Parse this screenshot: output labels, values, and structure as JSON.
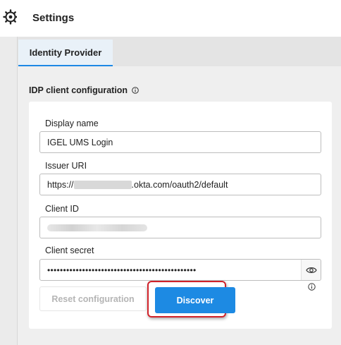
{
  "header": {
    "title": "Settings"
  },
  "tabs": [
    {
      "label": "Identity Provider",
      "active": true
    }
  ],
  "section": {
    "title": "IDP client configuration"
  },
  "form": {
    "display_name": {
      "label": "Display name",
      "value": "IGEL UMS Login"
    },
    "issuer_uri": {
      "label": "Issuer URI",
      "prefix": "https://",
      "suffix": ".okta.com/oauth2/default"
    },
    "client_id": {
      "label": "Client ID"
    },
    "client_secret": {
      "label": "Client secret",
      "value": "•••••••••••••••••••••••••••••••••••••••••••••••"
    }
  },
  "buttons": {
    "reset": "Reset configuration",
    "discover": "Discover"
  },
  "colors": {
    "accent": "#1d8ae3",
    "highlight": "#d0222a",
    "tab_underline": "#1e88e5"
  },
  "icons": {
    "nav": "settings-gear-icon",
    "info": "info-icon",
    "reveal": "eye-icon"
  }
}
